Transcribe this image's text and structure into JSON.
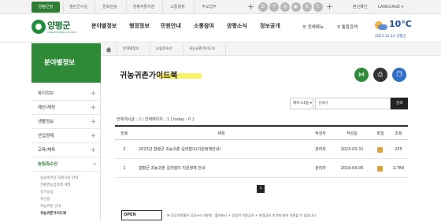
{
  "topbar": {
    "tabs": [
      "양평군청",
      "열린군수실",
      "문화관광",
      "양평자활지원",
      "소통행정",
      "주요업무"
    ],
    "plus": "+",
    "plus2": "+",
    "login": "본인확인",
    "language": "LANGUAGE"
  },
  "header": {
    "logo_name": "양평군",
    "logo_sub": "YANGPYEONG COUNTY",
    "nav": [
      "분야별정보",
      "행정정보",
      "민원안내",
      "소통참여",
      "양평소식",
      "정보공개"
    ],
    "all_menu": "전체메뉴",
    "search": "통합검색",
    "weather_temp": "10°C",
    "weather_date": "2023.12.12 양평군"
  },
  "sidebar": {
    "title": "분야별정보",
    "items": [
      {
        "label": "복지정보",
        "pm": "+"
      },
      {
        "label": "예산/재정",
        "pm": "+"
      },
      {
        "label": "생활정보",
        "pm": "+"
      },
      {
        "label": "산업경제",
        "pm": "+"
      },
      {
        "label": "교육/체육",
        "pm": "+"
      },
      {
        "label": "농림축수산",
        "pm": "-"
      }
    ],
    "subitems": [
      "농림축수산 지원사업 안내",
      "친환경농업정책 개발",
      "유기농업",
      "축산업",
      "귀농귀촌 안내",
      "귀농귀촌가이드북"
    ]
  },
  "breadcrumb": {
    "items": [
      "분야별정보",
      "농림축수산",
      "귀농귀촌가이드북"
    ]
  },
  "page": {
    "title": "귀농귀촌가이드북",
    "share_icon": "share-icon",
    "print_icon": "print-icon",
    "copy_icon": "copy-icon"
  },
  "search": {
    "select": "제목+내용",
    "placeholder": "검색어",
    "button": "검색"
  },
  "count": "전체게시글 : 2 / 전체페이지 : 1 [ today : 0 ]",
  "table": {
    "headers": [
      "번호",
      "제목",
      "작성자",
      "작성일",
      "파일",
      "조회"
    ],
    "rows": [
      {
        "no": "2",
        "title": "2023년 함평군 귀농귀촌 길라잡이(지원정책안내)",
        "author": "관리자",
        "date": "2023-03-31",
        "views": "255"
      },
      {
        "no": "1",
        "title": "함평군 귀농귀촌 길라잡이 지원정책 안내",
        "author": "관리자",
        "date": "2019-04-05",
        "views": "2,784"
      }
    ]
  },
  "pager": {
    "current": "1"
  },
  "footer": {
    "license": "OPEN",
    "notice": "본 공공저작물은 공공누리 4유형 : 출처표시 + 상업적 이용금지 + 변경금지 조건에 따라 이용할 수 있습니다."
  }
}
